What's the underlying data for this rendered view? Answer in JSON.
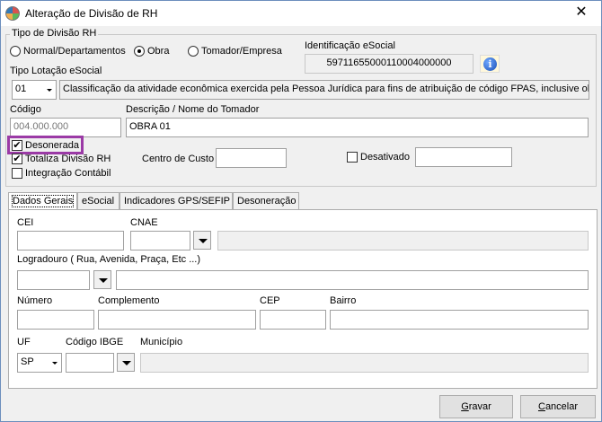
{
  "window": {
    "title": "Alteração de Divisão de RH",
    "close_glyph": "✕"
  },
  "tipo_divisao": {
    "label": "Tipo de Divisão RH",
    "options": [
      "Normal/Departamentos",
      "Obra",
      "Tomador/Empresa"
    ],
    "selected": "Obra"
  },
  "esocial_id": {
    "label": "Identificação eSocial",
    "value": "59711655000110004000000",
    "info_glyph": "i"
  },
  "tipo_lotacao": {
    "label": "Tipo Lotação eSocial",
    "code": "01",
    "description": "Classificação da atividade econômica exercida pela Pessoa Jurídica para fins de atribuição de código FPAS, inclusive obras"
  },
  "codigo": {
    "label": "Código",
    "value": "004.000.000"
  },
  "descricao": {
    "label": "Descrição / Nome do Tomador",
    "value": "OBRA 01"
  },
  "checks": {
    "desonerada": {
      "label": "Desonerada",
      "checked": true
    },
    "totaliza": {
      "label": "Totaliza Divisão RH",
      "checked": true
    },
    "integracao": {
      "label": "Integração Contábil",
      "checked": false
    },
    "desativado": {
      "label": "Desativado",
      "checked": false
    },
    "check_glyph": "✔"
  },
  "centro_custo": {
    "label": "Centro de Custo",
    "value": ""
  },
  "tabs": [
    "Dados Gerais",
    "eSocial",
    "Indicadores GPS/SEFIP",
    "Desoneração"
  ],
  "dados_gerais": {
    "cei": {
      "label": "CEI",
      "value": ""
    },
    "cnae": {
      "label": "CNAE",
      "value": ""
    },
    "logradouro": {
      "label": "Logradouro ( Rua, Avenida, Praça, Etc ...)",
      "value": ""
    },
    "numero": {
      "label": "Número",
      "value": ""
    },
    "complemento": {
      "label": "Complemento",
      "value": ""
    },
    "cep": {
      "label": "CEP",
      "value": ""
    },
    "bairro": {
      "label": "Bairro",
      "value": ""
    },
    "uf": {
      "label": "UF",
      "value": "SP"
    },
    "codigo_ibge": {
      "label": "Código IBGE",
      "value": ""
    },
    "municipio": {
      "label": "Município",
      "value": ""
    }
  },
  "buttons": {
    "gravar": {
      "label": "Gravar",
      "accel": "G",
      "rest": "ravar"
    },
    "cancelar": {
      "label": "Cancelar",
      "accel": "C",
      "rest": "ancelar"
    }
  },
  "colors": {
    "highlight": "#9b3aa6",
    "window_border": "#6d8fbd"
  }
}
